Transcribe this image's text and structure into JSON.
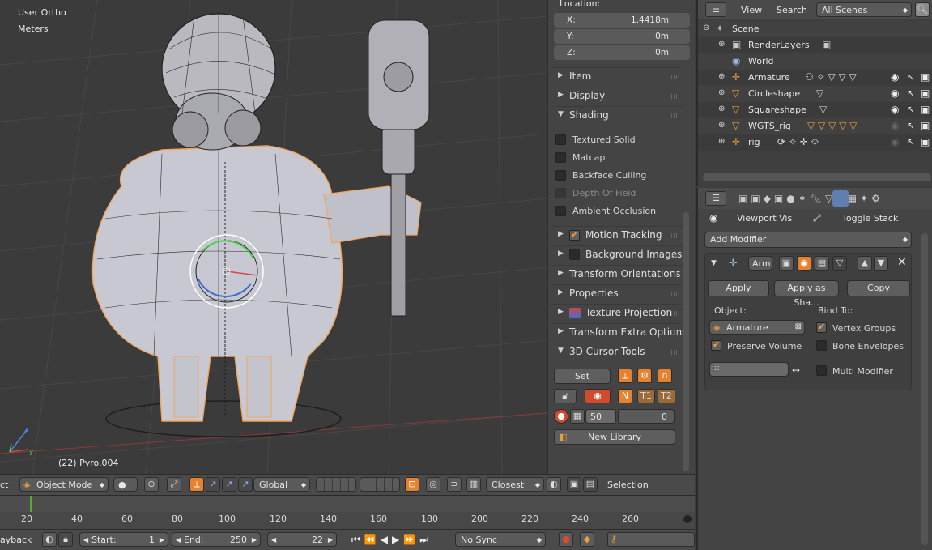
{
  "viewport": {
    "view_name": "User Ortho",
    "units": "Meters",
    "object_info": "(22) Pyro.004"
  },
  "npanel": {
    "location_label": "Location:",
    "x_label": "X:",
    "x_value": "1.4418m",
    "y_label": "Y:",
    "y_value": "0m",
    "z_label": "Z:",
    "z_value": "0m",
    "panels": [
      "Item",
      "Display",
      "Shading",
      "Motion Tracking",
      "Background Images",
      "Transform Orientations",
      "Properties",
      "Texture Projection",
      "Transform Extra Options",
      "3D Cursor Tools"
    ],
    "shading_options": [
      "Textured Solid",
      "Matcap",
      "Backface Culling",
      "Depth Of Field",
      "Ambient Occlusion"
    ],
    "cursor_tools": {
      "set_label": "Set",
      "n_label": "N",
      "t1_label": "T1",
      "t2_label": "T2",
      "number_value": "50",
      "number_value2": "0",
      "new_library_label": "New Library"
    }
  },
  "outliner": {
    "view_menu": "View",
    "search_menu": "Search",
    "scene_filter": "All Scenes",
    "rows": [
      "Scene",
      "RenderLayers",
      "World",
      "Armature",
      "Circleshape",
      "Squareshape",
      "WGTS_rig",
      "rig"
    ]
  },
  "properties": {
    "viewport_vis": "Viewport Vis",
    "toggle_stack": "Toggle Stack",
    "add_modifier": "Add Modifier",
    "modifier_name": "Arm",
    "apply_label": "Apply",
    "apply_as_label": "Apply as Sha...",
    "copy_label": "Copy",
    "object_label": "Object:",
    "object_value": "Armature",
    "bind_to_label": "Bind To:",
    "vertex_groups": "Vertex Groups",
    "preserve_volume": "Preserve Volume",
    "bone_envelopes": "Bone Envelopes",
    "multi_modifier": "Multi Modifier"
  },
  "vp_header": {
    "menu_stub": "ct",
    "mode": "Object Mode",
    "orientation": "Global",
    "snap_target": "Closest",
    "selection_label": "Selection"
  },
  "timeline": {
    "ticks": [
      "20",
      "40",
      "60",
      "80",
      "100",
      "120",
      "140",
      "160",
      "180",
      "200",
      "220",
      "240",
      "260"
    ],
    "playback_stub": "ayback",
    "start_label": "Start:",
    "start_value": "1",
    "end_label": "End:",
    "end_value": "250",
    "current_frame": "22",
    "sync": "No Sync"
  },
  "colors": {
    "accent": "#e6822e",
    "check": "#ff9d2b",
    "selection_outline": "#f2a65a",
    "frame_marker": "#5aa832"
  }
}
